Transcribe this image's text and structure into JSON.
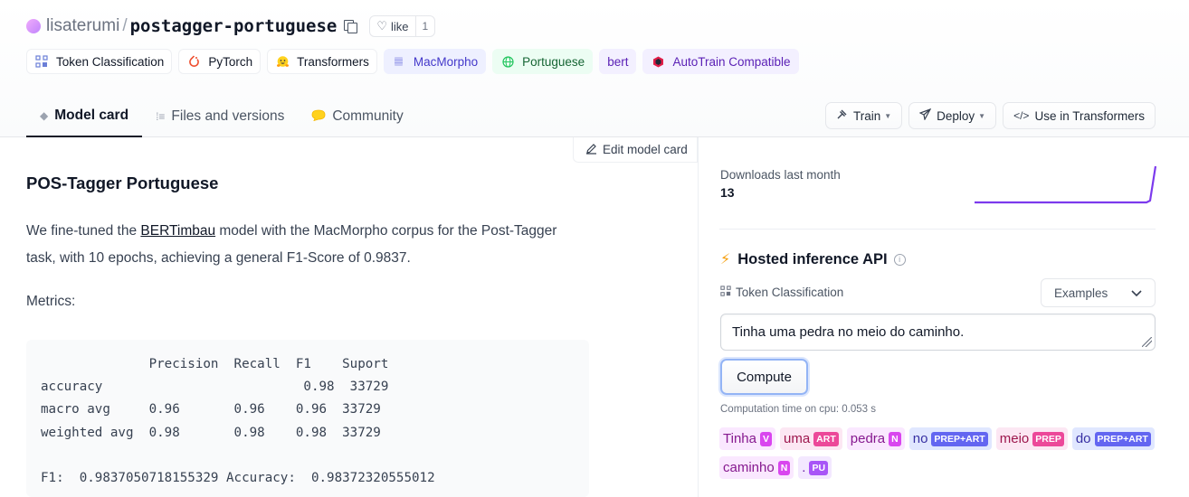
{
  "header": {
    "owner": "lisaterumi",
    "separator": "/",
    "repo": "postagger-portuguese",
    "like_label": "like",
    "like_count": "1",
    "tags": [
      {
        "label": "Token Classification",
        "icon": "token-classification-icon"
      },
      {
        "label": "PyTorch",
        "icon": "pytorch-icon"
      },
      {
        "label": "Transformers",
        "icon": "hugging-face-icon"
      },
      {
        "label": "MacMorpho",
        "icon": "dataset-icon"
      },
      {
        "label": "Portuguese",
        "icon": "globe-icon"
      },
      {
        "label": "bert",
        "icon": ""
      },
      {
        "label": "AutoTrain Compatible",
        "icon": "autotrain-icon"
      }
    ],
    "tabs": [
      {
        "label": "Model card",
        "icon": "cube-icon"
      },
      {
        "label": "Files and versions",
        "icon": "files-icon"
      },
      {
        "label": "Community",
        "icon": "community-icon"
      }
    ],
    "actions": {
      "train": "Train",
      "deploy": "Deploy",
      "use_in": "Use in Transformers"
    }
  },
  "main": {
    "edit_label": "Edit model card",
    "heading": "POS-Tagger Portuguese",
    "para_before": "We fine-tuned the ",
    "para_link": "BERTimbau",
    "para_after": " model with the MacMorpho corpus for the Post-Tagger task, with 10 epochs, achieving a general F1-Score of 0.9837.",
    "metrics_label": "Metrics:",
    "code": "              Precision  Recall  F1    Suport\naccuracy                          0.98  33729\nmacro avg     0.96       0.96    0.96  33729\nweighted avg  0.98       0.98    0.98  33729\n\nF1:  0.9837050718155329 Accuracy:  0.98372320555012"
  },
  "sidebar": {
    "downloads_label": "Downloads last month",
    "downloads_value": "13",
    "api_title": "Hosted inference API",
    "task_label": "Token Classification",
    "examples_label": "Examples",
    "input_text": "Tinha uma pedra no meio do caminho.",
    "compute_label": "Compute",
    "computation_time": "Computation time on cpu: 0.053 s",
    "tokens": [
      {
        "word": "Tinha",
        "tag": "V",
        "kind": "v"
      },
      {
        "word": "uma",
        "tag": "ART",
        "kind": "art"
      },
      {
        "word": "pedra",
        "tag": "N",
        "kind": "n"
      },
      {
        "word": "no",
        "tag": "PREP+ART",
        "kind": "pa"
      },
      {
        "word": "meio",
        "tag": "PREP",
        "kind": "prep"
      },
      {
        "word": "do",
        "tag": "PREP+ART",
        "kind": "pa"
      },
      {
        "word": "caminho",
        "tag": "N",
        "kind": "n"
      },
      {
        "word": ".",
        "tag": "PU",
        "kind": "pu"
      }
    ]
  },
  "colors": {
    "accent_purple": "#7c3aed",
    "bolt": "#f59e0b",
    "compute_border": "#93b4f5"
  }
}
